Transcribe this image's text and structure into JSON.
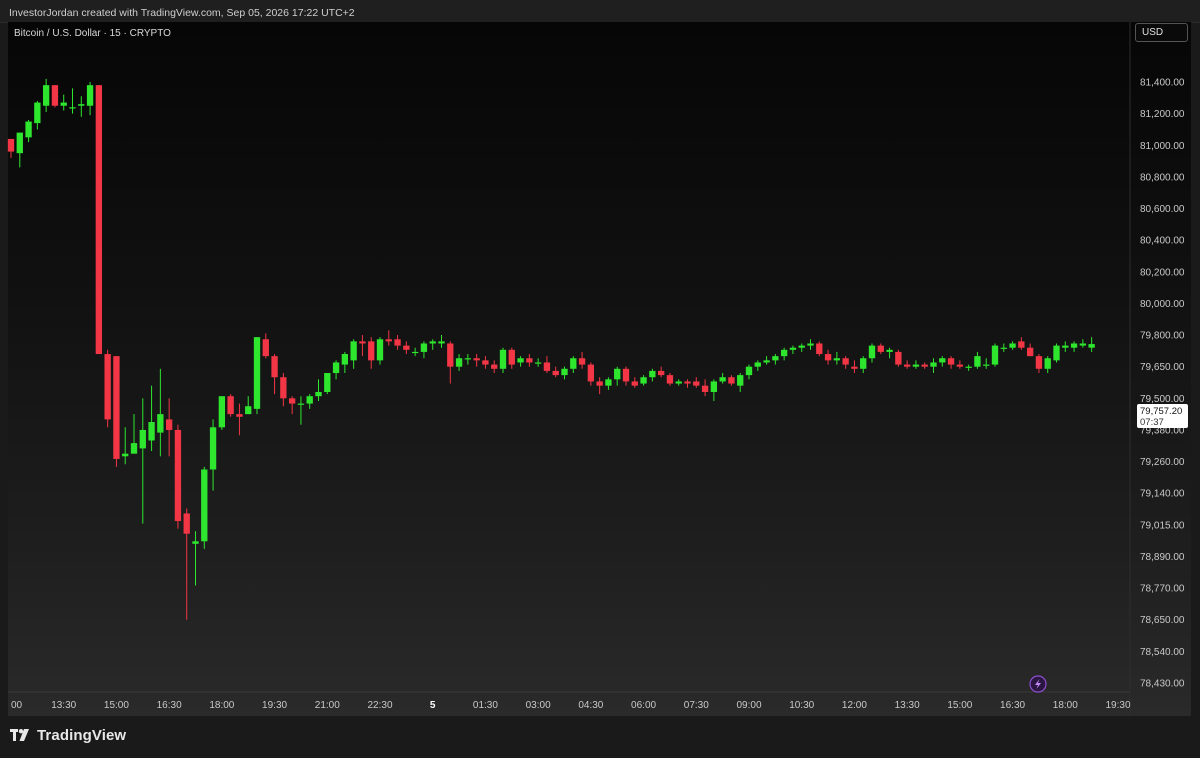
{
  "header": {
    "credit": "InvestorJordan created with TradingView.com, Sep 05, 2026 17:22 UTC+2"
  },
  "chart_title": "Bitcoin / U.S. Dollar · 15 · CRYPTO",
  "currency_label": "USD",
  "last_price": {
    "value": "79,757.20",
    "countdown": "07:37"
  },
  "branding": {
    "logo_text": "TradingView"
  },
  "colors": {
    "up": "#2ee62e",
    "down": "#f23645",
    "axis_text": "#c9c9c9",
    "background": "#0b0b0b"
  },
  "chart_data": {
    "type": "candlestick",
    "title": "Bitcoin / U.S. Dollar · 15 · CRYPTO",
    "y_axis": {
      "ticks": [
        {
          "label": "81,400.00",
          "value": 81400
        },
        {
          "label": "81,200.00",
          "value": 81200
        },
        {
          "label": "81,000.00",
          "value": 81000
        },
        {
          "label": "80,800.00",
          "value": 80800
        },
        {
          "label": "80,600.00",
          "value": 80600
        },
        {
          "label": "80,400.00",
          "value": 80400
        },
        {
          "label": "80,200.00",
          "value": 80200
        },
        {
          "label": "80,000.00",
          "value": 80000
        },
        {
          "label": "79,800.00",
          "value": 79800
        },
        {
          "label": "79,650.00",
          "value": 79650
        },
        {
          "label": "79,500.00",
          "value": 79500
        },
        {
          "label": "79,380.00",
          "value": 79380
        },
        {
          "label": "79,260.00",
          "value": 79260
        },
        {
          "label": "79,140.00",
          "value": 79140
        },
        {
          "label": "79,015.00",
          "value": 79015
        },
        {
          "label": "78,890.00",
          "value": 78890
        },
        {
          "label": "78,770.00",
          "value": 78770
        },
        {
          "label": "78,650.00",
          "value": 78650
        },
        {
          "label": "78,540.00",
          "value": 78540
        },
        {
          "label": "78,430.00",
          "value": 78430
        }
      ]
    },
    "x_axis": {
      "ticks": [
        {
          "label": "00",
          "minutes": 720
        },
        {
          "label": "13:30",
          "minutes": 810
        },
        {
          "label": "15:00",
          "minutes": 900
        },
        {
          "label": "16:30",
          "minutes": 990
        },
        {
          "label": "18:00",
          "minutes": 1080
        },
        {
          "label": "19:30",
          "minutes": 1170
        },
        {
          "label": "21:00",
          "minutes": 1260
        },
        {
          "label": "22:30",
          "minutes": 1350
        },
        {
          "label": "5",
          "minutes": 1440,
          "bold": true
        },
        {
          "label": "01:30",
          "minutes": 1530
        },
        {
          "label": "03:00",
          "minutes": 1620
        },
        {
          "label": "04:30",
          "minutes": 1710
        },
        {
          "label": "06:00",
          "minutes": 1800
        },
        {
          "label": "07:30",
          "minutes": 1890
        },
        {
          "label": "09:00",
          "minutes": 1980
        },
        {
          "label": "10:30",
          "minutes": 2070
        },
        {
          "label": "12:00",
          "minutes": 2160
        },
        {
          "label": "13:30",
          "minutes": 2250
        },
        {
          "label": "15:00",
          "minutes": 2340
        },
        {
          "label": "16:30",
          "minutes": 2430
        },
        {
          "label": "18:00",
          "minutes": 2520
        },
        {
          "label": "19:30",
          "minutes": 2610
        }
      ]
    },
    "grid": false,
    "interval_minutes": 15,
    "candles": [
      {
        "t": 720,
        "o": 81040,
        "h": 81040,
        "l": 80920,
        "c": 80960
      },
      {
        "t": 735,
        "o": 80950,
        "h": 81080,
        "l": 80860,
        "c": 81080
      },
      {
        "t": 750,
        "o": 81050,
        "h": 81160,
        "l": 81020,
        "c": 81150
      },
      {
        "t": 765,
        "o": 81140,
        "h": 81280,
        "l": 81100,
        "c": 81270
      },
      {
        "t": 780,
        "o": 81250,
        "h": 81420,
        "l": 81210,
        "c": 81380
      },
      {
        "t": 795,
        "o": 81380,
        "h": 81380,
        "l": 81240,
        "c": 81250
      },
      {
        "t": 810,
        "o": 81250,
        "h": 81320,
        "l": 81220,
        "c": 81270
      },
      {
        "t": 825,
        "o": 81240,
        "h": 81360,
        "l": 81200,
        "c": 81240
      },
      {
        "t": 840,
        "o": 81250,
        "h": 81310,
        "l": 81180,
        "c": 81260
      },
      {
        "t": 855,
        "o": 81250,
        "h": 81400,
        "l": 81190,
        "c": 81380
      },
      {
        "t": 870,
        "o": 81380,
        "h": 81380,
        "l": 79710,
        "c": 79710
      },
      {
        "t": 885,
        "o": 79710,
        "h": 79730,
        "l": 79390,
        "c": 79420
      },
      {
        "t": 900,
        "o": 79700,
        "h": 79700,
        "l": 79240,
        "c": 79270
      },
      {
        "t": 915,
        "o": 79280,
        "h": 79390,
        "l": 79250,
        "c": 79290
      },
      {
        "t": 930,
        "o": 79290,
        "h": 79440,
        "l": 79290,
        "c": 79330
      },
      {
        "t": 945,
        "o": 79310,
        "h": 79500,
        "l": 79020,
        "c": 79380
      },
      {
        "t": 960,
        "o": 79340,
        "h": 79560,
        "l": 79300,
        "c": 79410
      },
      {
        "t": 975,
        "o": 79370,
        "h": 79640,
        "l": 79280,
        "c": 79440
      },
      {
        "t": 990,
        "o": 79420,
        "h": 79500,
        "l": 79280,
        "c": 79380
      },
      {
        "t": 1005,
        "o": 79380,
        "h": 79400,
        "l": 79000,
        "c": 79030
      },
      {
        "t": 1020,
        "o": 79060,
        "h": 79080,
        "l": 78650,
        "c": 78980
      },
      {
        "t": 1035,
        "o": 78940,
        "h": 78990,
        "l": 78780,
        "c": 78950
      },
      {
        "t": 1050,
        "o": 78950,
        "h": 79240,
        "l": 78920,
        "c": 79230
      },
      {
        "t": 1065,
        "o": 79230,
        "h": 79420,
        "l": 79150,
        "c": 79390
      },
      {
        "t": 1080,
        "o": 79390,
        "h": 79510,
        "l": 79380,
        "c": 79510
      },
      {
        "t": 1095,
        "o": 79510,
        "h": 79520,
        "l": 79430,
        "c": 79440
      },
      {
        "t": 1110,
        "o": 79440,
        "h": 79480,
        "l": 79360,
        "c": 79430
      },
      {
        "t": 1125,
        "o": 79440,
        "h": 79510,
        "l": 79440,
        "c": 79470
      },
      {
        "t": 1140,
        "o": 79460,
        "h": 79790,
        "l": 79440,
        "c": 79790
      },
      {
        "t": 1155,
        "o": 79780,
        "h": 79810,
        "l": 79690,
        "c": 79700
      },
      {
        "t": 1170,
        "o": 79700,
        "h": 79710,
        "l": 79520,
        "c": 79600
      },
      {
        "t": 1185,
        "o": 79600,
        "h": 79620,
        "l": 79470,
        "c": 79500
      },
      {
        "t": 1200,
        "o": 79500,
        "h": 79510,
        "l": 79440,
        "c": 79480
      },
      {
        "t": 1215,
        "o": 79480,
        "h": 79510,
        "l": 79400,
        "c": 79480
      },
      {
        "t": 1230,
        "o": 79480,
        "h": 79520,
        "l": 79460,
        "c": 79510
      },
      {
        "t": 1245,
        "o": 79510,
        "h": 79590,
        "l": 79490,
        "c": 79530
      },
      {
        "t": 1260,
        "o": 79530,
        "h": 79620,
        "l": 79520,
        "c": 79620
      },
      {
        "t": 1275,
        "o": 79620,
        "h": 79680,
        "l": 79590,
        "c": 79670
      },
      {
        "t": 1290,
        "o": 79660,
        "h": 79720,
        "l": 79620,
        "c": 79710
      },
      {
        "t": 1305,
        "o": 79680,
        "h": 79780,
        "l": 79640,
        "c": 79770
      },
      {
        "t": 1320,
        "o": 79770,
        "h": 79800,
        "l": 79700,
        "c": 79760
      },
      {
        "t": 1335,
        "o": 79770,
        "h": 79790,
        "l": 79640,
        "c": 79680
      },
      {
        "t": 1350,
        "o": 79680,
        "h": 79790,
        "l": 79660,
        "c": 79780
      },
      {
        "t": 1365,
        "o": 79780,
        "h": 79830,
        "l": 79750,
        "c": 79770
      },
      {
        "t": 1380,
        "o": 79780,
        "h": 79800,
        "l": 79730,
        "c": 79750
      },
      {
        "t": 1395,
        "o": 79750,
        "h": 79770,
        "l": 79710,
        "c": 79730
      },
      {
        "t": 1410,
        "o": 79720,
        "h": 79740,
        "l": 79700,
        "c": 79720
      },
      {
        "t": 1425,
        "o": 79720,
        "h": 79770,
        "l": 79690,
        "c": 79760
      },
      {
        "t": 1440,
        "o": 79760,
        "h": 79780,
        "l": 79730,
        "c": 79770
      },
      {
        "t": 1455,
        "o": 79760,
        "h": 79800,
        "l": 79740,
        "c": 79770
      },
      {
        "t": 1470,
        "o": 79760,
        "h": 79770,
        "l": 79570,
        "c": 79650
      },
      {
        "t": 1485,
        "o": 79650,
        "h": 79710,
        "l": 79630,
        "c": 79690
      },
      {
        "t": 1500,
        "o": 79690,
        "h": 79710,
        "l": 79660,
        "c": 79690
      },
      {
        "t": 1515,
        "o": 79690,
        "h": 79710,
        "l": 79650,
        "c": 79680
      },
      {
        "t": 1530,
        "o": 79680,
        "h": 79700,
        "l": 79640,
        "c": 79660
      },
      {
        "t": 1545,
        "o": 79660,
        "h": 79680,
        "l": 79620,
        "c": 79640
      },
      {
        "t": 1560,
        "o": 79640,
        "h": 79740,
        "l": 79620,
        "c": 79730
      },
      {
        "t": 1575,
        "o": 79730,
        "h": 79740,
        "l": 79640,
        "c": 79660
      },
      {
        "t": 1590,
        "o": 79670,
        "h": 79700,
        "l": 79650,
        "c": 79690
      },
      {
        "t": 1605,
        "o": 79690,
        "h": 79710,
        "l": 79650,
        "c": 79670
      },
      {
        "t": 1620,
        "o": 79670,
        "h": 79690,
        "l": 79650,
        "c": 79670
      },
      {
        "t": 1635,
        "o": 79670,
        "h": 79700,
        "l": 79620,
        "c": 79630
      },
      {
        "t": 1650,
        "o": 79630,
        "h": 79650,
        "l": 79600,
        "c": 79610
      },
      {
        "t": 1665,
        "o": 79610,
        "h": 79650,
        "l": 79590,
        "c": 79640
      },
      {
        "t": 1680,
        "o": 79640,
        "h": 79700,
        "l": 79620,
        "c": 79690
      },
      {
        "t": 1695,
        "o": 79690,
        "h": 79720,
        "l": 79640,
        "c": 79660
      },
      {
        "t": 1710,
        "o": 79660,
        "h": 79670,
        "l": 79560,
        "c": 79580
      },
      {
        "t": 1725,
        "o": 79580,
        "h": 79600,
        "l": 79520,
        "c": 79560
      },
      {
        "t": 1740,
        "o": 79560,
        "h": 79600,
        "l": 79540,
        "c": 79590
      },
      {
        "t": 1755,
        "o": 79590,
        "h": 79650,
        "l": 79560,
        "c": 79640
      },
      {
        "t": 1770,
        "o": 79640,
        "h": 79650,
        "l": 79560,
        "c": 79580
      },
      {
        "t": 1785,
        "o": 79580,
        "h": 79600,
        "l": 79550,
        "c": 79560
      },
      {
        "t": 1800,
        "o": 79570,
        "h": 79610,
        "l": 79560,
        "c": 79600
      },
      {
        "t": 1815,
        "o": 79600,
        "h": 79640,
        "l": 79580,
        "c": 79630
      },
      {
        "t": 1830,
        "o": 79630,
        "h": 79650,
        "l": 79600,
        "c": 79610
      },
      {
        "t": 1845,
        "o": 79610,
        "h": 79620,
        "l": 79560,
        "c": 79570
      },
      {
        "t": 1860,
        "o": 79570,
        "h": 79590,
        "l": 79560,
        "c": 79580
      },
      {
        "t": 1875,
        "o": 79580,
        "h": 79590,
        "l": 79550,
        "c": 79570
      },
      {
        "t": 1890,
        "o": 79580,
        "h": 79600,
        "l": 79550,
        "c": 79560
      },
      {
        "t": 1905,
        "o": 79560,
        "h": 79590,
        "l": 79510,
        "c": 79530
      },
      {
        "t": 1920,
        "o": 79530,
        "h": 79590,
        "l": 79490,
        "c": 79580
      },
      {
        "t": 1935,
        "o": 79580,
        "h": 79620,
        "l": 79570,
        "c": 79600
      },
      {
        "t": 1950,
        "o": 79600,
        "h": 79610,
        "l": 79560,
        "c": 79570
      },
      {
        "t": 1965,
        "o": 79560,
        "h": 79620,
        "l": 79530,
        "c": 79610
      },
      {
        "t": 1980,
        "o": 79610,
        "h": 79660,
        "l": 79590,
        "c": 79650
      },
      {
        "t": 1995,
        "o": 79650,
        "h": 79680,
        "l": 79630,
        "c": 79670
      },
      {
        "t": 2010,
        "o": 79670,
        "h": 79700,
        "l": 79660,
        "c": 79680
      },
      {
        "t": 2025,
        "o": 79680,
        "h": 79710,
        "l": 79660,
        "c": 79700
      },
      {
        "t": 2040,
        "o": 79700,
        "h": 79740,
        "l": 79680,
        "c": 79730
      },
      {
        "t": 2055,
        "o": 79730,
        "h": 79750,
        "l": 79710,
        "c": 79740
      },
      {
        "t": 2070,
        "o": 79740,
        "h": 79760,
        "l": 79720,
        "c": 79750
      },
      {
        "t": 2085,
        "o": 79750,
        "h": 79780,
        "l": 79730,
        "c": 79760
      },
      {
        "t": 2100,
        "o": 79760,
        "h": 79770,
        "l": 79700,
        "c": 79710
      },
      {
        "t": 2115,
        "o": 79710,
        "h": 79730,
        "l": 79660,
        "c": 79680
      },
      {
        "t": 2130,
        "o": 79680,
        "h": 79720,
        "l": 79660,
        "c": 79690
      },
      {
        "t": 2145,
        "o": 79690,
        "h": 79700,
        "l": 79640,
        "c": 79660
      },
      {
        "t": 2160,
        "o": 79650,
        "h": 79680,
        "l": 79620,
        "c": 79640
      },
      {
        "t": 2175,
        "o": 79640,
        "h": 79700,
        "l": 79620,
        "c": 79690
      },
      {
        "t": 2190,
        "o": 79690,
        "h": 79760,
        "l": 79670,
        "c": 79750
      },
      {
        "t": 2205,
        "o": 79750,
        "h": 79760,
        "l": 79710,
        "c": 79720
      },
      {
        "t": 2220,
        "o": 79720,
        "h": 79740,
        "l": 79690,
        "c": 79730
      },
      {
        "t": 2235,
        "o": 79720,
        "h": 79730,
        "l": 79650,
        "c": 79660
      },
      {
        "t": 2250,
        "o": 79660,
        "h": 79680,
        "l": 79640,
        "c": 79650
      },
      {
        "t": 2265,
        "o": 79650,
        "h": 79680,
        "l": 79640,
        "c": 79660
      },
      {
        "t": 2280,
        "o": 79660,
        "h": 79670,
        "l": 79640,
        "c": 79650
      },
      {
        "t": 2295,
        "o": 79650,
        "h": 79690,
        "l": 79620,
        "c": 79670
      },
      {
        "t": 2310,
        "o": 79670,
        "h": 79700,
        "l": 79650,
        "c": 79690
      },
      {
        "t": 2325,
        "o": 79690,
        "h": 79700,
        "l": 79640,
        "c": 79660
      },
      {
        "t": 2340,
        "o": 79660,
        "h": 79680,
        "l": 79640,
        "c": 79650
      },
      {
        "t": 2355,
        "o": 79650,
        "h": 79660,
        "l": 79630,
        "c": 79650
      },
      {
        "t": 2370,
        "o": 79650,
        "h": 79720,
        "l": 79640,
        "c": 79700
      },
      {
        "t": 2385,
        "o": 79660,
        "h": 79690,
        "l": 79640,
        "c": 79660
      },
      {
        "t": 2400,
        "o": 79660,
        "h": 79760,
        "l": 79650,
        "c": 79750
      },
      {
        "t": 2415,
        "o": 79740,
        "h": 79760,
        "l": 79720,
        "c": 79740
      },
      {
        "t": 2430,
        "o": 79740,
        "h": 79770,
        "l": 79730,
        "c": 79760
      },
      {
        "t": 2445,
        "o": 79770,
        "h": 79790,
        "l": 79730,
        "c": 79740
      },
      {
        "t": 2460,
        "o": 79740,
        "h": 79760,
        "l": 79700,
        "c": 79700
      },
      {
        "t": 2475,
        "o": 79700,
        "h": 79710,
        "l": 79620,
        "c": 79640
      },
      {
        "t": 2490,
        "o": 79640,
        "h": 79700,
        "l": 79620,
        "c": 79690
      },
      {
        "t": 2505,
        "o": 79680,
        "h": 79760,
        "l": 79670,
        "c": 79750
      },
      {
        "t": 2520,
        "o": 79740,
        "h": 79770,
        "l": 79720,
        "c": 79750
      },
      {
        "t": 2535,
        "o": 79740,
        "h": 79770,
        "l": 79720,
        "c": 79760
      },
      {
        "t": 2550,
        "o": 79750,
        "h": 79780,
        "l": 79740,
        "c": 79760
      },
      {
        "t": 2565,
        "o": 79740,
        "h": 79790,
        "l": 79720,
        "c": 79757.2
      }
    ]
  }
}
